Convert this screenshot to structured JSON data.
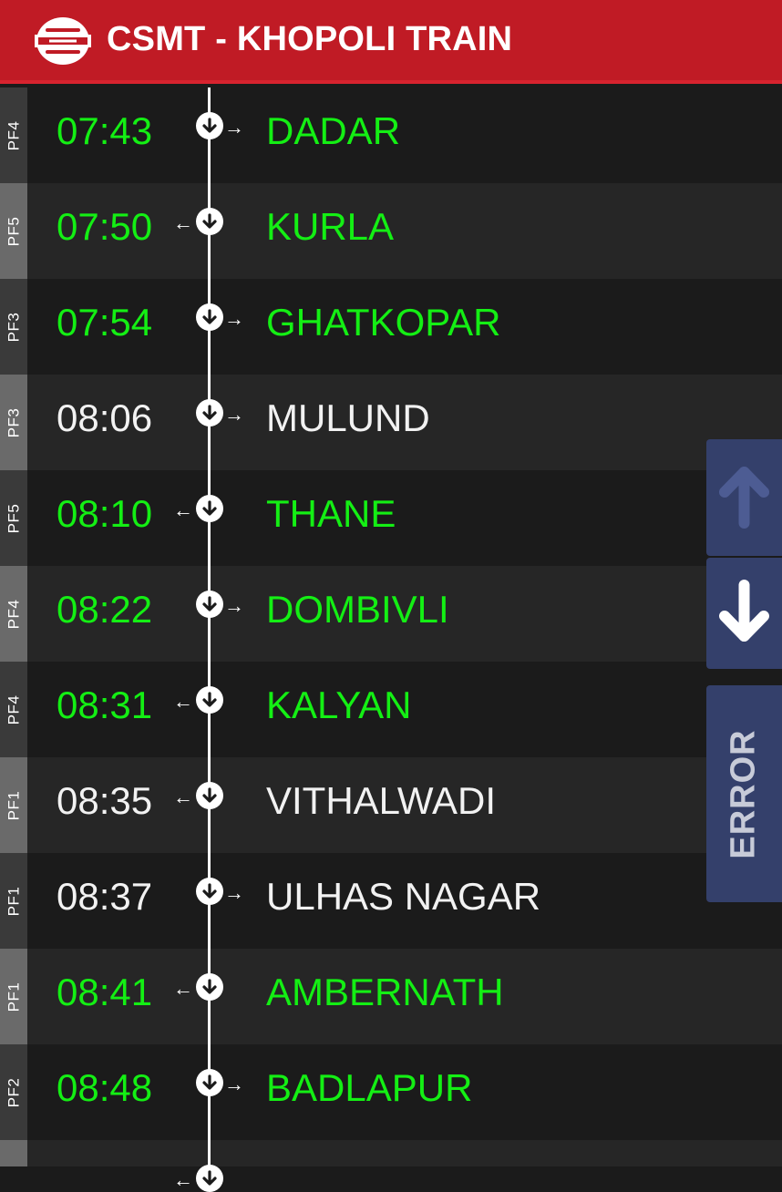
{
  "header": {
    "title": "CSMT - KHOPOLI TRAIN",
    "brand_color": "#c01b25"
  },
  "stops": [
    {
      "pf": "PF4",
      "time": "07:43",
      "station": "DADAR",
      "status": "green",
      "side": "right"
    },
    {
      "pf": "PF5",
      "time": "07:50",
      "station": "KURLA",
      "status": "green",
      "side": "left"
    },
    {
      "pf": "PF3",
      "time": "07:54",
      "station": "GHATKOPAR",
      "status": "green",
      "side": "right"
    },
    {
      "pf": "PF3",
      "time": "08:06",
      "station": "MULUND",
      "status": "white",
      "side": "right"
    },
    {
      "pf": "PF5",
      "time": "08:10",
      "station": "THANE",
      "status": "green",
      "side": "left"
    },
    {
      "pf": "PF4",
      "time": "08:22",
      "station": "DOMBIVLI",
      "status": "green",
      "side": "right"
    },
    {
      "pf": "PF4",
      "time": "08:31",
      "station": "KALYAN",
      "status": "green",
      "side": "left"
    },
    {
      "pf": "PF1",
      "time": "08:35",
      "station": "VITHALWADI",
      "status": "white",
      "side": "left"
    },
    {
      "pf": "PF1",
      "time": "08:37",
      "station": "ULHAS NAGAR",
      "status": "white",
      "side": "right"
    },
    {
      "pf": "PF1",
      "time": "08:41",
      "station": "AMBERNATH",
      "status": "green",
      "side": "left"
    },
    {
      "pf": "PF2",
      "time": "08:48",
      "station": "BADLAPUR",
      "status": "green",
      "side": "right"
    },
    {
      "pf": "",
      "time": "",
      "station": "",
      "status": "white",
      "side": "left"
    }
  ],
  "controls": {
    "scroll_up_icon": "arrow-up-icon",
    "scroll_down_icon": "arrow-down-icon",
    "error_label": "ERROR"
  },
  "colors": {
    "on_time": "#14ef14",
    "default": "#f2f2f2",
    "side_panel": "#34406b"
  }
}
